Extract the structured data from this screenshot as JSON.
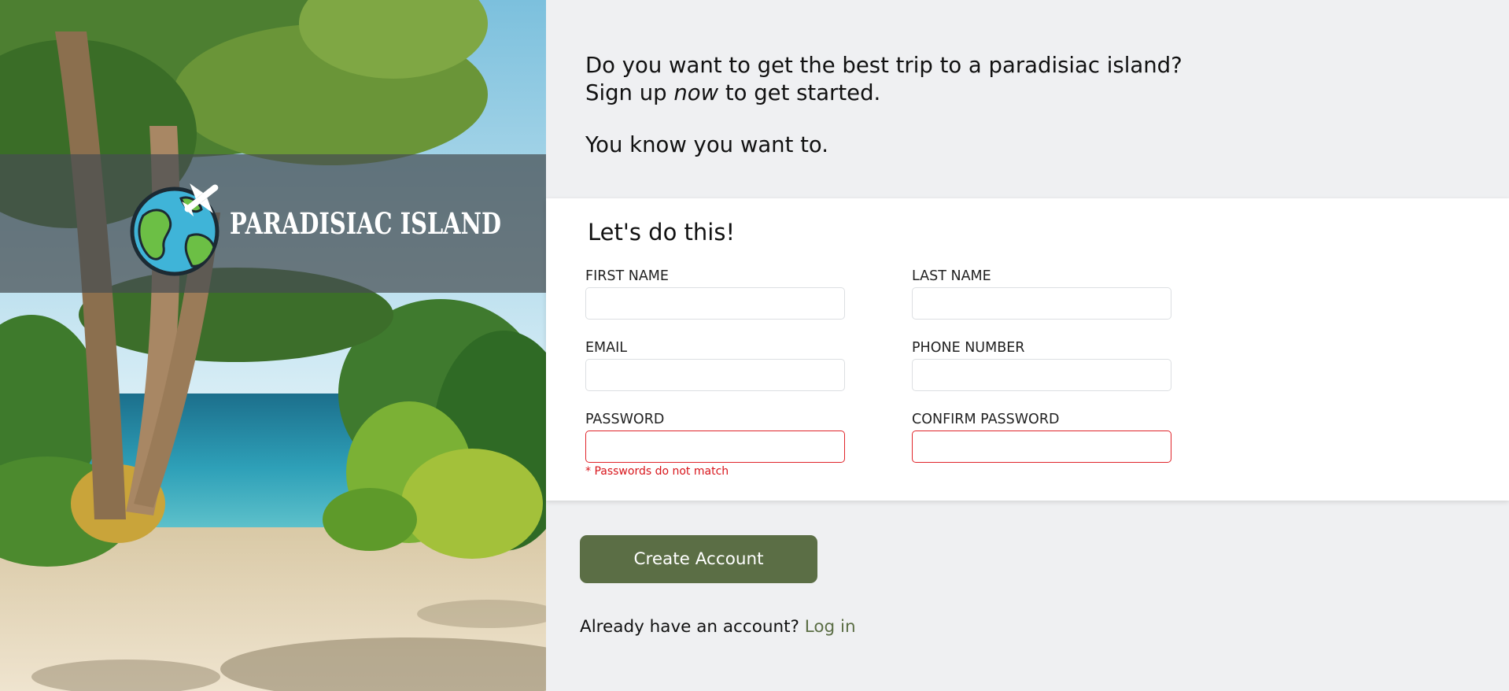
{
  "brand": {
    "name": "PARADISIAC ISLAND",
    "logo_icon": "globe-airplane-icon"
  },
  "intro": {
    "line1_before": "Do you want to get the best trip to a paradisiac island? Sign up ",
    "line1_emphasis": "now",
    "line1_after": " to get started.",
    "line2": "You know you want to."
  },
  "form": {
    "title": "Let's do this!",
    "first_name": {
      "label": "FIRST NAME",
      "value": ""
    },
    "last_name": {
      "label": "LAST NAME",
      "value": ""
    },
    "email": {
      "label": "EMAIL",
      "value": ""
    },
    "phone": {
      "label": "PHONE NUMBER",
      "value": ""
    },
    "password": {
      "label": "PASSWORD",
      "value": ""
    },
    "confirm_password": {
      "label": "CONFIRM PASSWORD",
      "value": ""
    },
    "error": "* Passwords do not match",
    "submit_label": "Create Account"
  },
  "login": {
    "prompt": "Already have an account?",
    "link_label": "Log in"
  },
  "colors": {
    "accent": "#5b6e45",
    "error": "#d8141a",
    "page_background": "#eff0f2",
    "card_background": "#ffffff"
  }
}
